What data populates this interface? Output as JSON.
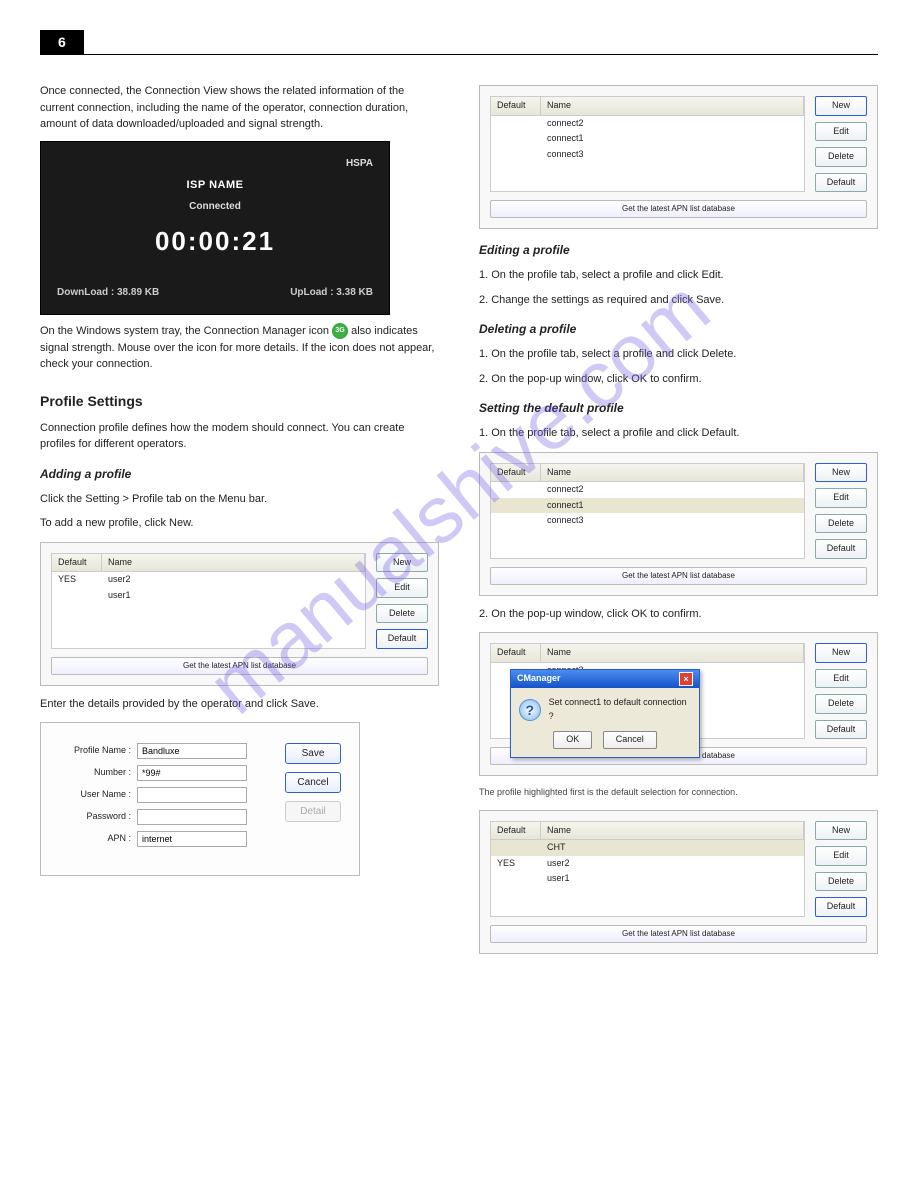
{
  "watermark": "manualshive.com",
  "header": {
    "pageNum": "6"
  },
  "left": {
    "intro1": "Once connected, the Connection View shows the related information of the current connection, including the name of the operator, connection duration, amount of data downloaded/uploaded and signal strength.",
    "isp": {
      "hspa": "HSPA",
      "name": "ISP NAME",
      "status": "Connected",
      "time": "00:00:21",
      "dl_label": "DownLoad : 38.89 KB",
      "ul_label": "UpLoad : 3.38 KB"
    },
    "intro2": "On the Windows system tray, the Connection Manager icon",
    "intro2b": "also indicates signal strength. Mouse over the icon for more",
    "intro2c": "details. If the icon does not appear, check your connection.",
    "profile_title": "Profile Settings",
    "profile_intro": "Connection profile defines how the modem should connect. You can create profiles for different operators.",
    "sub1": "Adding a profile",
    "p1a": "Click the Setting > Profile tab on the Menu bar.",
    "p1b": "To add a new profile, click New.",
    "profiles1": {
      "head_default": "Default",
      "head_name": "Name",
      "rows": [
        {
          "def": "YES",
          "name": "user2"
        },
        {
          "def": "",
          "name": "user1"
        }
      ],
      "btn_new": "New",
      "btn_edit": "Edit",
      "btn_del": "Delete",
      "btn_default": "Default",
      "apn_btn": "Get the latest APN list database"
    },
    "p2": "Enter the details provided by the operator and click Save.",
    "form": {
      "l_profile": "Profile Name :",
      "l_number": "Number :",
      "l_user": "User Name :",
      "l_pass": "Password :",
      "l_apn": "APN :",
      "v_profile": "Bandluxe",
      "v_number": "*99#",
      "v_user": "",
      "v_pass": "",
      "v_apn": "internet",
      "btn_save": "Save",
      "btn_cancel": "Cancel",
      "btn_detail": "Detail"
    }
  },
  "right": {
    "profiles2": {
      "head_default": "Default",
      "head_name": "Name",
      "rows": [
        {
          "def": "",
          "name": "connect2"
        },
        {
          "def": "",
          "name": "connect1"
        },
        {
          "def": "",
          "name": "connect3"
        }
      ],
      "btn_new": "New",
      "btn_edit": "Edit",
      "btn_del": "Delete",
      "btn_default": "Default",
      "apn_btn": "Get the latest APN list database"
    },
    "sub_edit": "Editing a profile",
    "edit1": "1. On the profile tab, select a profile and click Edit.",
    "edit2": "2. Change the settings as required and click Save.",
    "sub_del": "Deleting a profile",
    "del1": "1. On the profile tab, select a profile and click Delete.",
    "del2": "2. On the pop-up window, click OK to confirm.",
    "sub_set": "Setting the default profile",
    "set1": "1. On the profile tab, select a profile and click Default.",
    "profiles3": {
      "head_default": "Default",
      "head_name": "Name",
      "rows": [
        {
          "def": "",
          "name": "connect2"
        },
        {
          "def": "",
          "name": "connect1"
        },
        {
          "def": "",
          "name": "connect3"
        }
      ],
      "btn_new": "New",
      "btn_edit": "Edit",
      "btn_del": "Delete",
      "btn_default": "Default",
      "apn_btn": "Get the latest APN list database"
    },
    "set2": "2. On the pop-up window, click OK to confirm.",
    "dlg": {
      "title": "CManager",
      "msg": "Set connect1 to default connection ?",
      "ok": "OK",
      "cancel": "Cancel"
    },
    "note": "The profile highlighted first is the default selection for connection.",
    "profiles4": {
      "head_default": "Default",
      "head_name": "Name",
      "rows": [
        {
          "def": "",
          "name": "CHT"
        },
        {
          "def": "YES",
          "name": "user2"
        },
        {
          "def": "",
          "name": "user1"
        }
      ],
      "btn_new": "New",
      "btn_edit": "Edit",
      "btn_del": "Delete",
      "btn_default": "Default",
      "apn_btn": "Get the latest APN list database"
    }
  }
}
